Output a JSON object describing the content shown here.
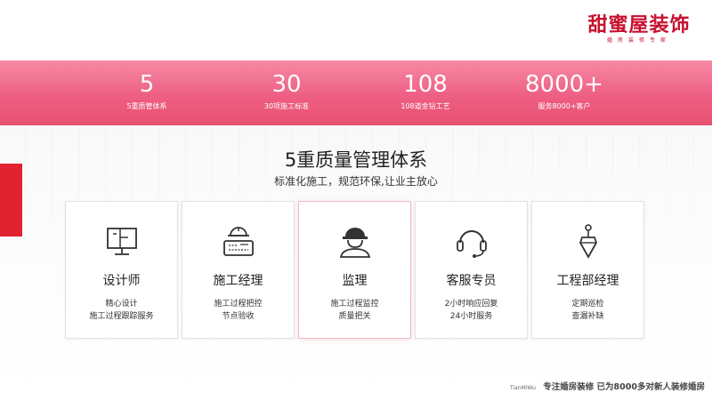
{
  "logo": {
    "name": "甜蜜屋装饰",
    "tagline": "婚房装修专家"
  },
  "stats": [
    {
      "value": "5",
      "label": "5重质管体系"
    },
    {
      "value": "30",
      "label": "30项施工标准"
    },
    {
      "value": "108",
      "label": "108道金钻工艺"
    },
    {
      "value": "8000+",
      "label": "服务8000+客户"
    }
  ],
  "section": {
    "title": "5重质量管理体系",
    "subtitle": "标准化施工，规范环保,让业主放心"
  },
  "cards": [
    {
      "title": "设计师",
      "desc_line1": "精心设计",
      "desc_line2": "施工过程跟踪服务",
      "icon": "monitor-icon"
    },
    {
      "title": "施工经理",
      "desc_line1": "施工过程把控",
      "desc_line2": "节点验收",
      "icon": "blueprint-worker-icon"
    },
    {
      "title": "监理",
      "desc_line1": "施工过程监控",
      "desc_line2": "质量把关",
      "icon": "hardhat-person-icon"
    },
    {
      "title": "客服专员",
      "desc_line1": "2小时响应回复",
      "desc_line2": "24小时服务",
      "icon": "headset-icon"
    },
    {
      "title": "工程部经理",
      "desc_line1": "定期巡检",
      "desc_line2": "查漏补缺",
      "icon": "plumb-bob-icon"
    }
  ],
  "footer": {
    "brand": "TianMiWu",
    "text": "专注婚房装修 已为8000多对新人装修婚房"
  },
  "colors": {
    "accent": "#e8506f",
    "brand": "#c8102e",
    "left_accent": "#e0232f"
  }
}
